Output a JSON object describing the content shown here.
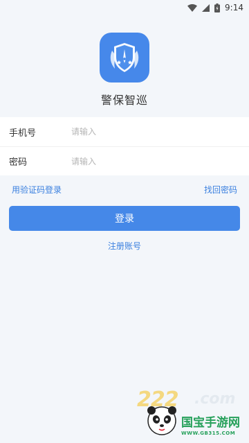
{
  "status_bar": {
    "time": "9:14",
    "icons": [
      "wifi-icon",
      "signal-icon",
      "battery-icon"
    ]
  },
  "app": {
    "name": "警保智巡",
    "logo_icon": "shield-compass-icon",
    "accent_color": "#4688ea"
  },
  "form": {
    "phone_label": "手机号",
    "phone_placeholder": "请输入",
    "password_label": "密码",
    "password_placeholder": "请输入"
  },
  "links": {
    "sms_login": "用验证码登录",
    "forgot_password": "找回密码",
    "register": "注册账号"
  },
  "login_button": "登录",
  "watermark": {
    "digits": "222",
    "domain_suffix": ".com",
    "brand": "国宝手游网",
    "url": "WWW.GB315.COM",
    "icon": "panda-icon"
  }
}
